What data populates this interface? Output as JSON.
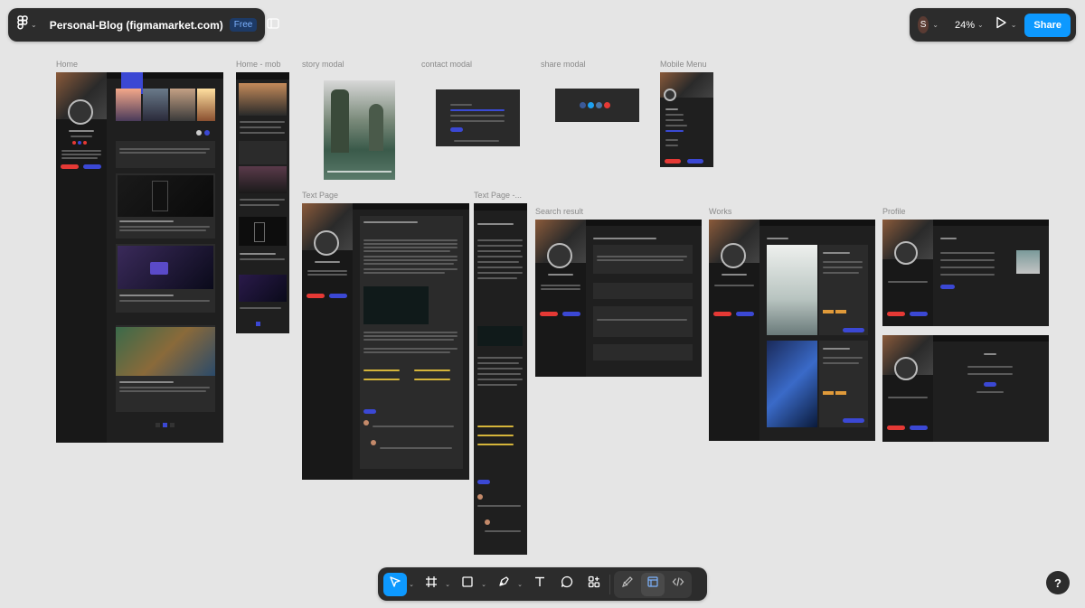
{
  "file": {
    "name": "Personal-Blog (figmamarket.com)",
    "plan_badge": "Free"
  },
  "header": {
    "user_initial": "S",
    "zoom": "24%",
    "share_label": "Share"
  },
  "frames": {
    "home": "Home",
    "home_mob": "Home - mob",
    "story_modal": "story modal",
    "contact_modal": "contact modal",
    "share_modal": "share modal",
    "mobile_menu": "Mobile Menu",
    "text_page": "Text Page",
    "text_page_mob": "Text Page -...",
    "search_result": "Search result",
    "works": "Works",
    "profile": "Profile"
  },
  "tools": [
    {
      "name": "move-tool",
      "icon": "cursor-icon",
      "active": true
    },
    {
      "name": "frame-tool",
      "icon": "frame-icon"
    },
    {
      "name": "shape-tool",
      "icon": "rectangle-icon"
    },
    {
      "name": "pen-tool",
      "icon": "pen-icon"
    },
    {
      "name": "text-tool",
      "icon": "text-icon"
    },
    {
      "name": "comment-tool",
      "icon": "comment-icon"
    },
    {
      "name": "actions-tool",
      "icon": "actions-icon"
    }
  ],
  "help_label": "?",
  "colors": {
    "toolbar": "#2c2c2c",
    "accent": "#0d99ff",
    "canvas": "#e5e5e5",
    "frame": "#1f1f1f"
  }
}
